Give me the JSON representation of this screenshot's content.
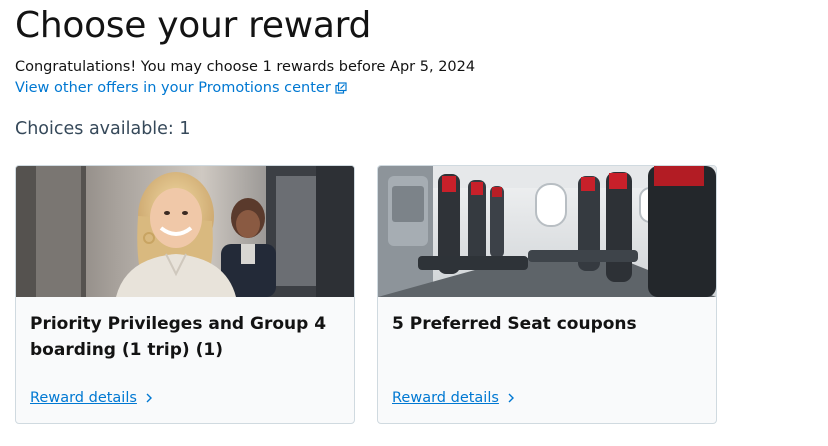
{
  "header": {
    "title": "Choose your reward",
    "subtitle": "Congratulations! You may choose 1 rewards before Apr 5, 2024",
    "promo_link": "View other offers in your Promotions center",
    "promo_link_icon": "external-link-icon"
  },
  "choices": {
    "label": "Choices available: 1"
  },
  "cards": [
    {
      "title": "Priority Privileges and Group 4 boarding (1 trip) (1)",
      "link": "Reward details",
      "image": "smiling-passenger-with-flight-attendant-photo"
    },
    {
      "title": "5 Preferred Seat coupons",
      "link": "Reward details",
      "image": "airplane-cabin-seats-photo"
    }
  ],
  "colors": {
    "link": "#0078d2",
    "text": "#131313",
    "card_border": "#d0dae0",
    "card_bg": "#f9fafb"
  }
}
